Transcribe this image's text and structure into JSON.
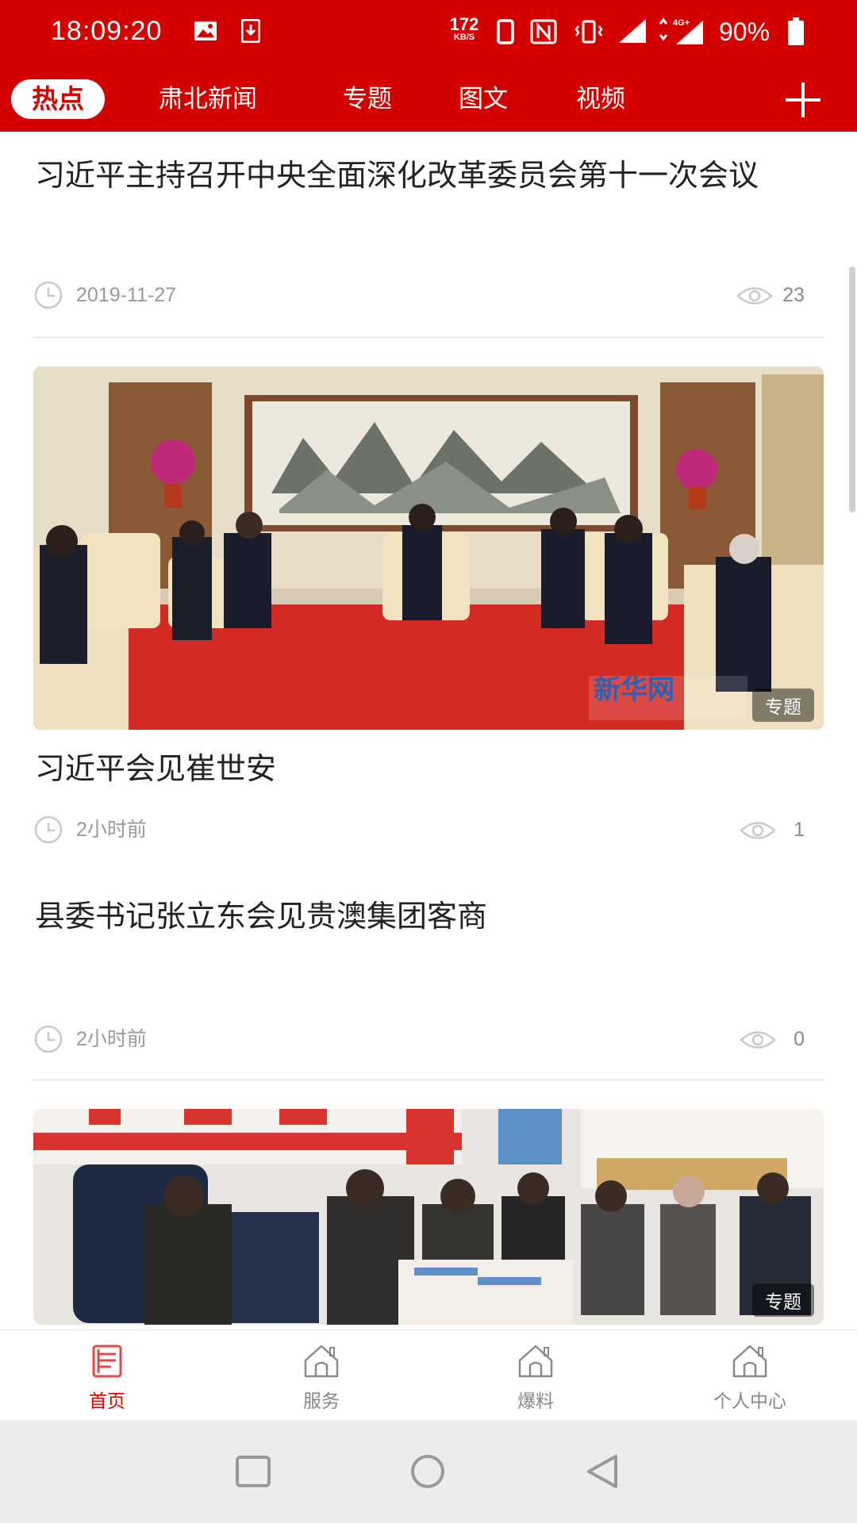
{
  "status_bar": {
    "time": "18:09:20",
    "net_speed_value": "172",
    "net_speed_unit": "KB/S",
    "network": "4G+",
    "battery": "90%"
  },
  "channels": [
    {
      "label": "热点",
      "active": true
    },
    {
      "label": "肃北新闻",
      "active": false
    },
    {
      "label": "专题",
      "active": false
    },
    {
      "label": "图文",
      "active": false
    },
    {
      "label": "视频",
      "active": false
    }
  ],
  "icons": {
    "add_channel": "plus-icon",
    "time": "clock-icon",
    "views": "eye-icon"
  },
  "feed": [
    {
      "title": "习近平主持召开中央全面深化改革委员会第十一次会议",
      "date": "2019-11-27",
      "views": "23"
    },
    {
      "title": "习近平会见崔世安",
      "date": "2小时前",
      "views": "1",
      "badge": "专题",
      "watermark": "新华网"
    },
    {
      "title": "县委书记张立东会见贵澳集团客商",
      "date": "2小时前",
      "views": "0"
    },
    {
      "badge": "专题"
    }
  ],
  "bottom_nav": [
    {
      "label": "首页",
      "active": true
    },
    {
      "label": "服务",
      "active": false
    },
    {
      "label": "爆料",
      "active": false
    },
    {
      "label": "个人中心",
      "active": false
    }
  ],
  "colors": {
    "brand_red": "#d40000",
    "text_dark": "#222222",
    "text_muted": "#9a9a9a"
  }
}
